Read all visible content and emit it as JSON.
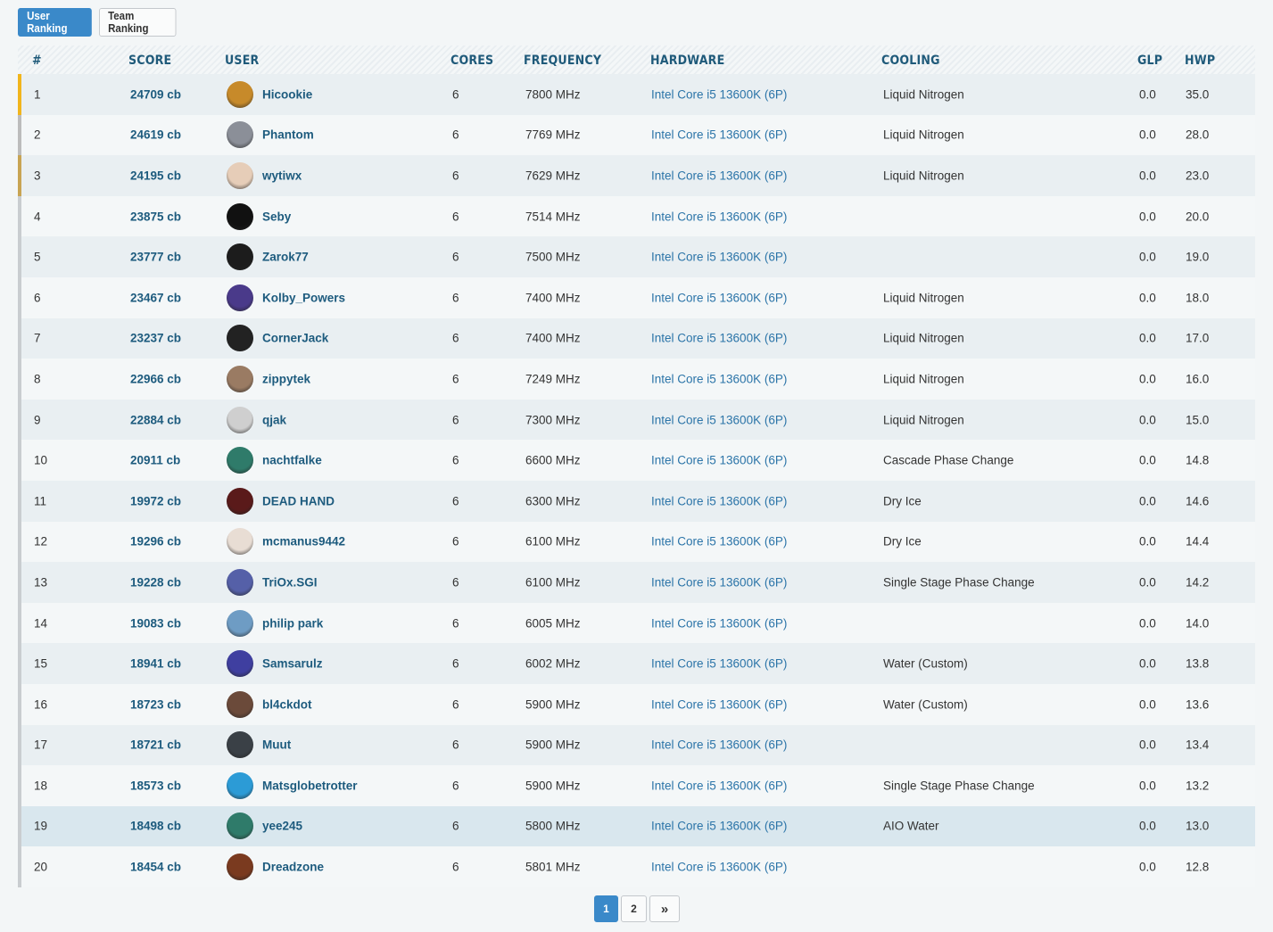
{
  "tabs": {
    "user_ranking": "User Ranking",
    "team_ranking": "Team Ranking"
  },
  "columns": {
    "rank": "#",
    "score": "SCORE",
    "user": "USER",
    "cores": "CORES",
    "frequency": "FREQUENCY",
    "hardware": "HARDWARE",
    "cooling": "COOLING",
    "glp": "GLP",
    "hwp": "HWP"
  },
  "rank_stripe_colors": {
    "gold": "#f1b51c",
    "silver": "#bcbcbc",
    "bronze": "#c8a453",
    "default": "#c9cdd0"
  },
  "rows": [
    {
      "rank": "1",
      "score": "24709 cb",
      "user": "Hicookie",
      "cores": "6",
      "frequency": "7800 MHz",
      "hardware": "Intel Core i5 13600K (6P)",
      "cooling": "Liquid Nitrogen",
      "glp": "0.0",
      "hwp": "35.0",
      "avatar": "#c78a2a"
    },
    {
      "rank": "2",
      "score": "24619 cb",
      "user": "Phantom",
      "cores": "6",
      "frequency": "7769 MHz",
      "hardware": "Intel Core i5 13600K (6P)",
      "cooling": "Liquid Nitrogen",
      "glp": "0.0",
      "hwp": "28.0",
      "avatar": "#8b8f98"
    },
    {
      "rank": "3",
      "score": "24195 cb",
      "user": "wytiwx",
      "cores": "6",
      "frequency": "7629 MHz",
      "hardware": "Intel Core i5 13600K (6P)",
      "cooling": "Liquid Nitrogen",
      "glp": "0.0",
      "hwp": "23.0",
      "avatar": "#e6cdb8"
    },
    {
      "rank": "4",
      "score": "23875 cb",
      "user": "Seby",
      "cores": "6",
      "frequency": "7514 MHz",
      "hardware": "Intel Core i5 13600K (6P)",
      "cooling": "",
      "glp": "0.0",
      "hwp": "20.0",
      "avatar": "#111111"
    },
    {
      "rank": "5",
      "score": "23777 cb",
      "user": "Zarok77",
      "cores": "6",
      "frequency": "7500 MHz",
      "hardware": "Intel Core i5 13600K (6P)",
      "cooling": "",
      "glp": "0.0",
      "hwp": "19.0",
      "avatar": "#1c1c1c"
    },
    {
      "rank": "6",
      "score": "23467 cb",
      "user": "Kolby_Powers",
      "cores": "6",
      "frequency": "7400 MHz",
      "hardware": "Intel Core i5 13600K (6P)",
      "cooling": "Liquid Nitrogen",
      "glp": "0.0",
      "hwp": "18.0",
      "avatar": "#4a3a8a"
    },
    {
      "rank": "7",
      "score": "23237 cb",
      "user": "CornerJack",
      "cores": "6",
      "frequency": "7400 MHz",
      "hardware": "Intel Core i5 13600K (6P)",
      "cooling": "Liquid Nitrogen",
      "glp": "0.0",
      "hwp": "17.0",
      "avatar": "#222222"
    },
    {
      "rank": "8",
      "score": "22966 cb",
      "user": "zippytek",
      "cores": "6",
      "frequency": "7249 MHz",
      "hardware": "Intel Core i5 13600K (6P)",
      "cooling": "Liquid Nitrogen",
      "glp": "0.0",
      "hwp": "16.0",
      "avatar": "#9a7b63"
    },
    {
      "rank": "9",
      "score": "22884 cb",
      "user": "qjak",
      "cores": "6",
      "frequency": "7300 MHz",
      "hardware": "Intel Core i5 13600K (6P)",
      "cooling": "Liquid Nitrogen",
      "glp": "0.0",
      "hwp": "15.0",
      "avatar": "#cfcfcf"
    },
    {
      "rank": "10",
      "score": "20911 cb",
      "user": "nachtfalke",
      "cores": "6",
      "frequency": "6600 MHz",
      "hardware": "Intel Core i5 13600K (6P)",
      "cooling": "Cascade Phase Change",
      "glp": "0.0",
      "hwp": "14.8",
      "avatar": "#2f7b6a"
    },
    {
      "rank": "11",
      "score": "19972 cb",
      "user": "DEAD HAND",
      "cores": "6",
      "frequency": "6300 MHz",
      "hardware": "Intel Core i5 13600K (6P)",
      "cooling": "Dry Ice",
      "glp": "0.0",
      "hwp": "14.6",
      "avatar": "#5a1a1a"
    },
    {
      "rank": "12",
      "score": "19296 cb",
      "user": "mcmanus9442",
      "cores": "6",
      "frequency": "6100 MHz",
      "hardware": "Intel Core i5 13600K (6P)",
      "cooling": "Dry Ice",
      "glp": "0.0",
      "hwp": "14.4",
      "avatar": "#e8ddd4"
    },
    {
      "rank": "13",
      "score": "19228 cb",
      "user": "TriOx.SGI",
      "cores": "6",
      "frequency": "6100 MHz",
      "hardware": "Intel Core i5 13600K (6P)",
      "cooling": "Single Stage Phase Change",
      "glp": "0.0",
      "hwp": "14.2",
      "avatar": "#5560a8"
    },
    {
      "rank": "14",
      "score": "19083 cb",
      "user": "philip park",
      "cores": "6",
      "frequency": "6005 MHz",
      "hardware": "Intel Core i5 13600K (6P)",
      "cooling": "",
      "glp": "0.0",
      "hwp": "14.0",
      "avatar": "#6e9cc4"
    },
    {
      "rank": "15",
      "score": "18941 cb",
      "user": "Samsarulz",
      "cores": "6",
      "frequency": "6002 MHz",
      "hardware": "Intel Core i5 13600K (6P)",
      "cooling": "Water (Custom)",
      "glp": "0.0",
      "hwp": "13.8",
      "avatar": "#3f3fa0"
    },
    {
      "rank": "16",
      "score": "18723 cb",
      "user": "bl4ckdot",
      "cores": "6",
      "frequency": "5900 MHz",
      "hardware": "Intel Core i5 13600K (6P)",
      "cooling": "Water (Custom)",
      "glp": "0.0",
      "hwp": "13.6",
      "avatar": "#6b4a3a"
    },
    {
      "rank": "17",
      "score": "18721 cb",
      "user": "Muut",
      "cores": "6",
      "frequency": "5900 MHz",
      "hardware": "Intel Core i5 13600K (6P)",
      "cooling": "",
      "glp": "0.0",
      "hwp": "13.4",
      "avatar": "#3a4046"
    },
    {
      "rank": "18",
      "score": "18573 cb",
      "user": "Matsglobetrotter",
      "cores": "6",
      "frequency": "5900 MHz",
      "hardware": "Intel Core i5 13600K (6P)",
      "cooling": "Single Stage Phase Change",
      "glp": "0.0",
      "hwp": "13.2",
      "avatar": "#2c9bd6"
    },
    {
      "rank": "19",
      "score": "18498 cb",
      "user": "yee245",
      "cores": "6",
      "frequency": "5800 MHz",
      "hardware": "Intel Core i5 13600K (6P)",
      "cooling": "AIO Water",
      "glp": "0.0",
      "hwp": "13.0",
      "avatar": "#2f7b6a"
    },
    {
      "rank": "20",
      "score": "18454 cb",
      "user": "Dreadzone",
      "cores": "6",
      "frequency": "5801 MHz",
      "hardware": "Intel Core i5 13600K (6P)",
      "cooling": "",
      "glp": "0.0",
      "hwp": "12.8",
      "avatar": "#7a3a1f"
    }
  ],
  "pagination": {
    "page1": "1",
    "page2": "2",
    "next_icon": "»"
  }
}
